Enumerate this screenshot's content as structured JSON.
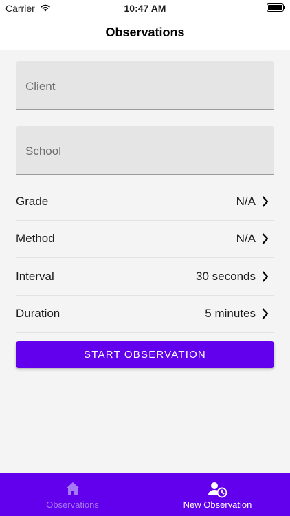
{
  "status_bar": {
    "carrier": "Carrier",
    "time": "10:47 AM",
    "icons": [
      "wifi-icon",
      "battery-icon"
    ]
  },
  "header": {
    "title": "Observations"
  },
  "form": {
    "client_placeholder": "Client",
    "school_placeholder": "School",
    "settings": [
      {
        "label": "Grade",
        "value": "N/A"
      },
      {
        "label": "Method",
        "value": "N/A"
      },
      {
        "label": "Interval",
        "value": "30 seconds"
      },
      {
        "label": "Duration",
        "value": "5 minutes"
      }
    ],
    "start_button": "START OBSERVATION"
  },
  "tab_bar": {
    "tabs": [
      {
        "label": "Observations",
        "icon": "home-icon",
        "active": false
      },
      {
        "label": "New Observation",
        "icon": "user-clock-icon",
        "active": true
      }
    ]
  },
  "colors": {
    "accent": "#6200ee",
    "inactive_tab": "#a77af5",
    "field_background": "#e5e5e5",
    "page_background": "#f4f4f4"
  }
}
